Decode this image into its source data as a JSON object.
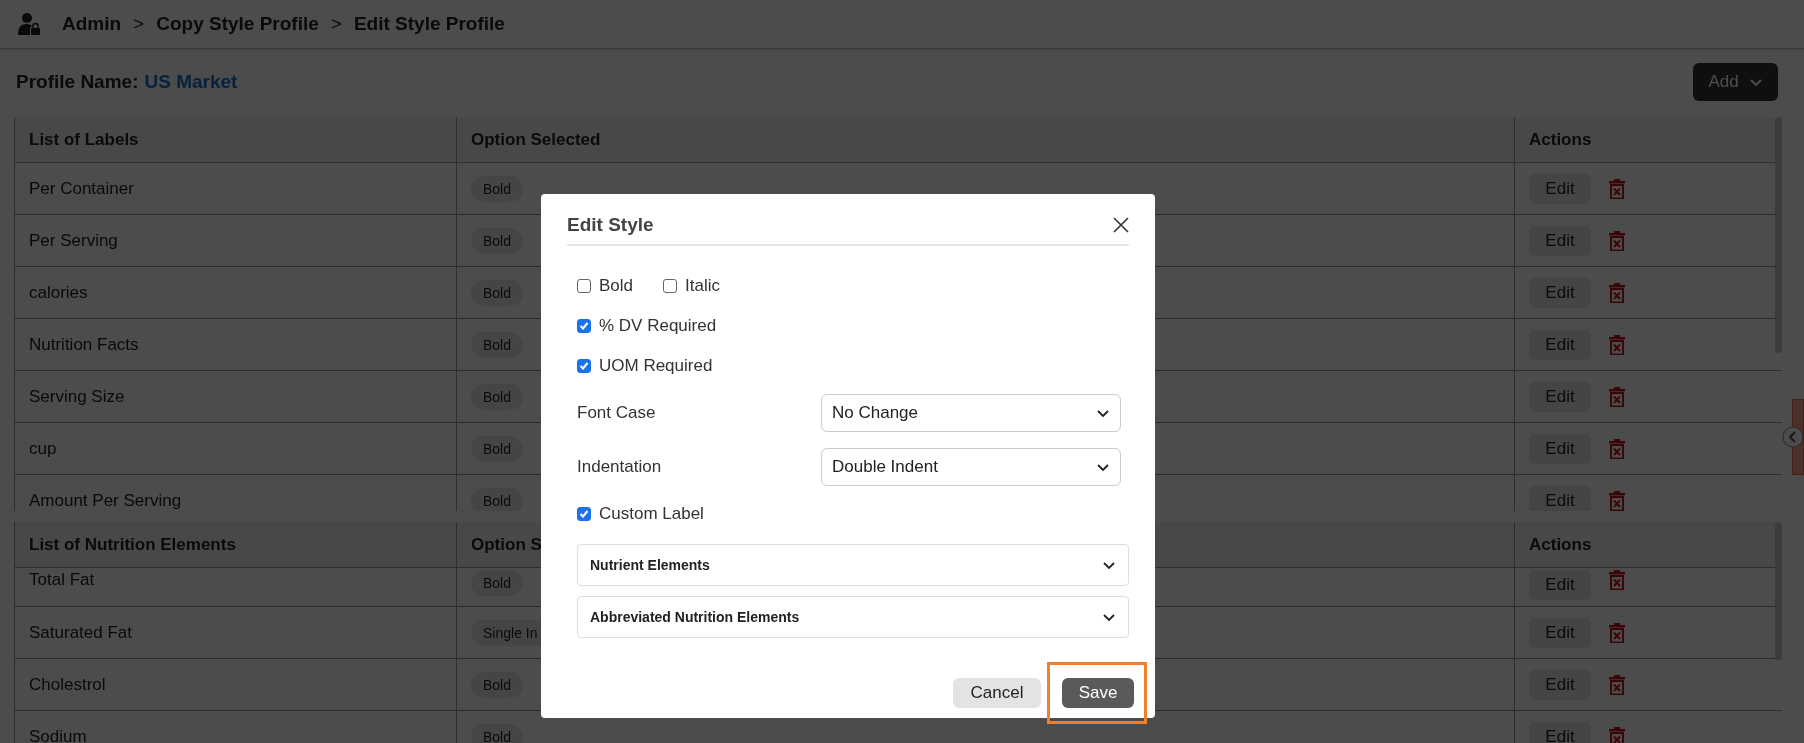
{
  "breadcrumb": [
    "Admin",
    ">",
    "Copy Style Profile",
    ">",
    "Edit Style Profile"
  ],
  "profile": {
    "label": "Profile Name:",
    "value": "US Market"
  },
  "add_button": {
    "label": "Add"
  },
  "tables": [
    {
      "columns": [
        "List of Labels",
        "Option Selected",
        "Actions"
      ],
      "rows": [
        {
          "label": "Per Container",
          "option": "Bold",
          "action": "Edit"
        },
        {
          "label": "Per Serving",
          "option": "Bold",
          "action": "Edit"
        },
        {
          "label": "calories",
          "option": "Bold",
          "action": "Edit"
        },
        {
          "label": "Nutrition Facts",
          "option": "Bold",
          "action": "Edit"
        },
        {
          "label": "Serving Size",
          "option": "Bold",
          "action": "Edit"
        },
        {
          "label": "cup",
          "option": "Bold",
          "action": "Edit"
        },
        {
          "label": "Amount Per Serving",
          "option": "Bold",
          "action": "Edit"
        }
      ]
    },
    {
      "columns": [
        "List of Nutrition Elements",
        "Option S",
        "Actions"
      ],
      "rows": [
        {
          "label": "Total Fat",
          "option": "Bold",
          "action": "Edit"
        },
        {
          "label": "Saturated Fat",
          "option": "Single In",
          "action": "Edit"
        },
        {
          "label": "Cholestrol",
          "option": "Bold",
          "action": "Edit"
        },
        {
          "label": "Sodium",
          "option": "Bold",
          "action": "Edit"
        }
      ]
    }
  ],
  "modal": {
    "title": "Edit Style",
    "checkbox_rows": [
      [
        {
          "label": "Bold",
          "checked": false
        },
        {
          "label": "Italic",
          "checked": false
        }
      ],
      [
        {
          "label": "% DV Required",
          "checked": true
        }
      ],
      [
        {
          "label": "UOM Required",
          "checked": true
        }
      ]
    ],
    "selects": [
      {
        "label": "Font Case",
        "value": "No Change"
      },
      {
        "label": "Indentation",
        "value": "Double Indent"
      }
    ],
    "custom_label": {
      "label": "Custom Label",
      "checked": true
    },
    "accordions": [
      {
        "title": "Nutrient Elements",
        "expanded": false
      },
      {
        "title": "Abbreviated Nutrition Elements",
        "expanded": false
      }
    ],
    "buttons": [
      {
        "label": "Cancel",
        "kind": "secondary",
        "highlighted": false
      },
      {
        "label": "Save",
        "kind": "primary",
        "highlighted": true
      }
    ]
  }
}
